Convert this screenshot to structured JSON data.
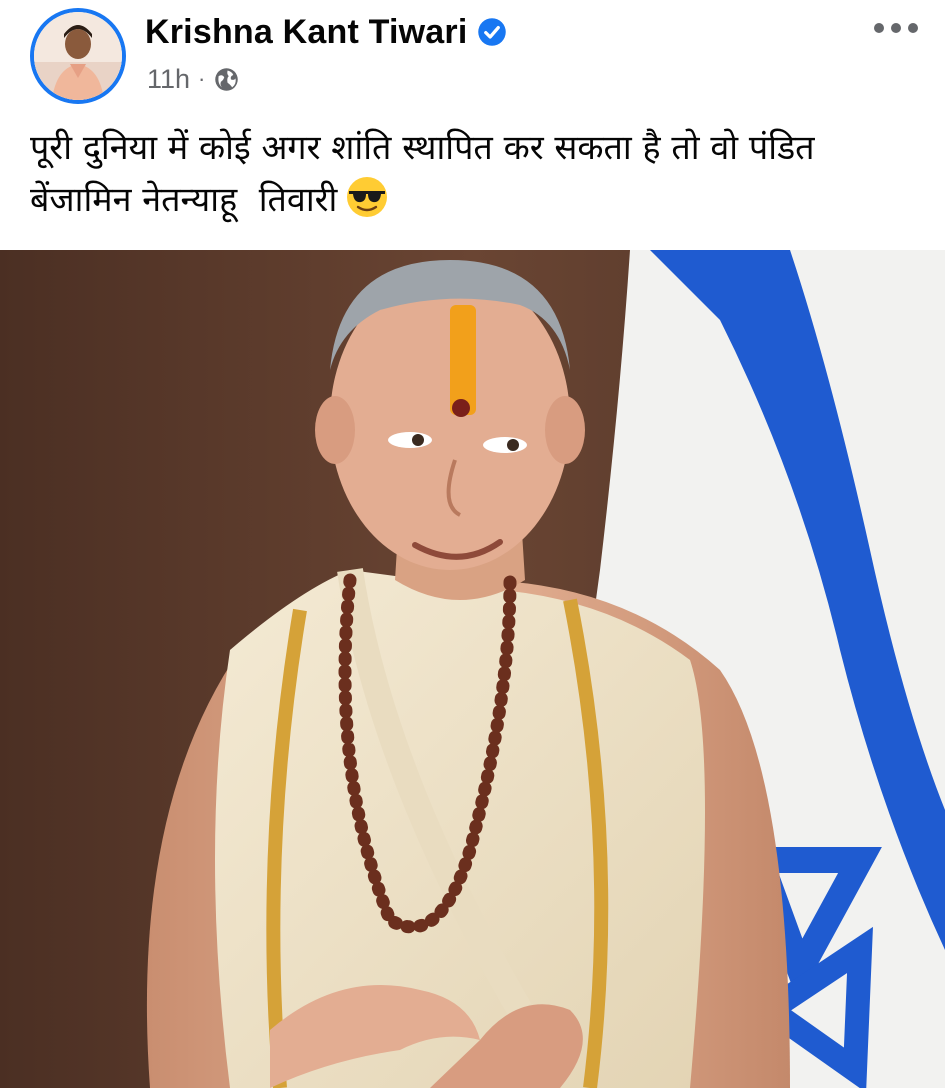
{
  "post": {
    "author": {
      "name": "Krishna Kant Tiwari",
      "verified": true,
      "avatar_icon": "profile-photo-icon"
    },
    "meta": {
      "time": "11h",
      "separator": "·",
      "audience_icon": "globe-icon"
    },
    "menu_icon": "more-options-icon",
    "caption": {
      "text": "पूरी दुनिया में कोई अगर शांति स्थापित कर सकता है तो वो पंडित बेंजामिन नेतन्याहू  तिवारी",
      "emoji": "😎"
    },
    "photo": {
      "icon": "post-photo"
    }
  },
  "colors": {
    "verified_blue": "#1877f2",
    "meta_gray": "#65676b",
    "text_black": "#050505",
    "flag_blue": "#1f5bd0"
  }
}
